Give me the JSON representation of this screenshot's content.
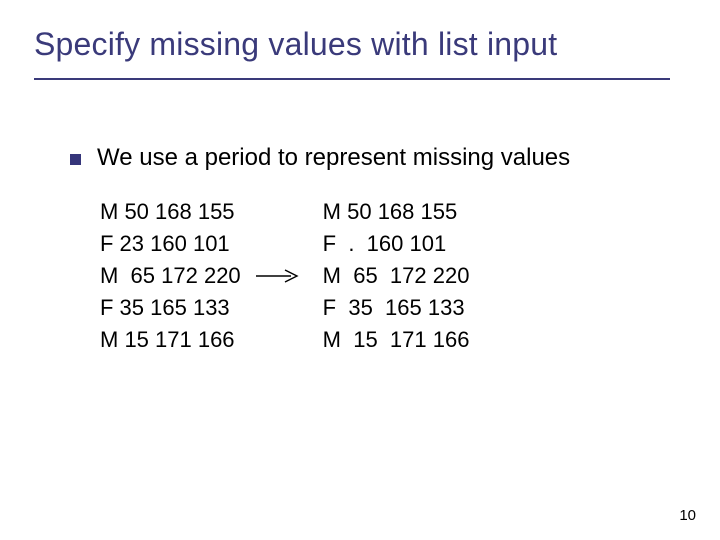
{
  "title": "Specify missing values with list input",
  "bullet": "We use a period to represent missing values",
  "left_block": "M 50 168 155\nF 23 160 101\nM  65 172 220\nF 35 165 133\nM 15 171 166",
  "right_block": "M 50 168 155\nF  .  160 101\nM  65  172 220\nF  35  165 133\nM  15  171 166",
  "page_number": "10"
}
